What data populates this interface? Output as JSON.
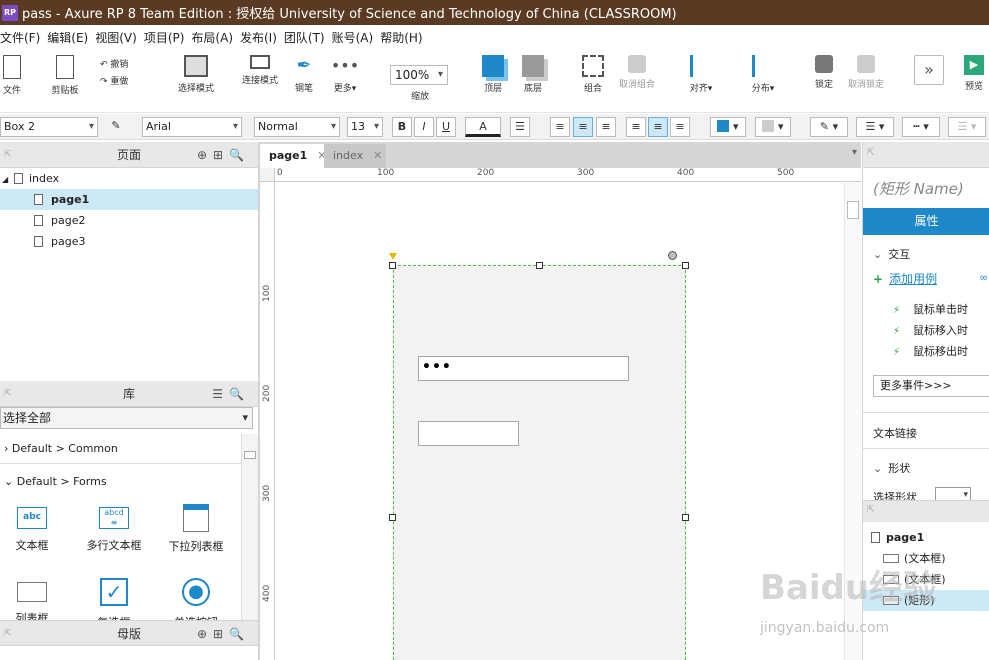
{
  "titlebar": {
    "logo": "RP",
    "title": "pass - Axure RP 8 Team Edition : 授权给 University of Science and Technology of China (CLASSROOM)"
  },
  "menu": [
    "文件(F)",
    "编辑(E)",
    "视图(V)",
    "项目(P)",
    "布局(A)",
    "发布(I)",
    "团队(T)",
    "账号(A)",
    "帮助(H)"
  ],
  "toolbar": {
    "file": "文件",
    "clipboard": "剪贴板",
    "undo": "撤销",
    "redo": "重做",
    "select_mode": "选择模式",
    "connect_mode": "连接模式",
    "pen": "钢笔",
    "more": "更多▾",
    "zoom_value": "100%",
    "zoom": "缩放",
    "top": "顶层",
    "bottom": "底层",
    "group": "组合",
    "ungroup": "取消组合",
    "align": "对齐▾",
    "distribute": "分布▾",
    "lock": "锁定",
    "unlock": "取消锁定",
    "preview": "预览"
  },
  "format": {
    "widget_name": "Box 2",
    "font": "Arial",
    "style": "Normal",
    "size": "13",
    "bold": "B",
    "italic": "I",
    "underline": "U",
    "font_color": "A"
  },
  "pages_panel": {
    "title": "页面",
    "pages": [
      {
        "label": "index"
      },
      {
        "label": "page1"
      },
      {
        "label": "page2"
      },
      {
        "label": "page3"
      }
    ]
  },
  "library_panel": {
    "title": "库",
    "select_label": "选择全部",
    "groups": [
      "Default > Common",
      "Default > Forms"
    ],
    "widgets": [
      "文本框",
      "多行文本框",
      "下拉列表框",
      "列表框",
      "复选框",
      "单选按钮"
    ]
  },
  "masters_panel": {
    "title": "母版"
  },
  "canvas": {
    "tabs": [
      {
        "label": "page1"
      },
      {
        "label": "index"
      }
    ],
    "ruler_top": [
      "0",
      "100",
      "200",
      "300",
      "400",
      "500"
    ],
    "ruler_left": [
      "100",
      "200",
      "300",
      "400"
    ],
    "password_value": "•••"
  },
  "inspector": {
    "shape_name": "(矩形 Name)",
    "tab_label": "属性",
    "interaction": "交互",
    "add_case": "添加用例",
    "events": [
      "鼠标单击时",
      "鼠标移入时",
      "鼠标移出时"
    ],
    "more_events": "更多事件>>>",
    "text_link": "文本链接",
    "shape": "形状",
    "select_shape": "选择形状"
  },
  "outline": {
    "page": "page1",
    "items": [
      "(文本框)",
      "(文本框)",
      "(矩形)"
    ]
  },
  "watermark": {
    "brand": "Baidu经验",
    "url": "jingyan.baidu.com"
  }
}
